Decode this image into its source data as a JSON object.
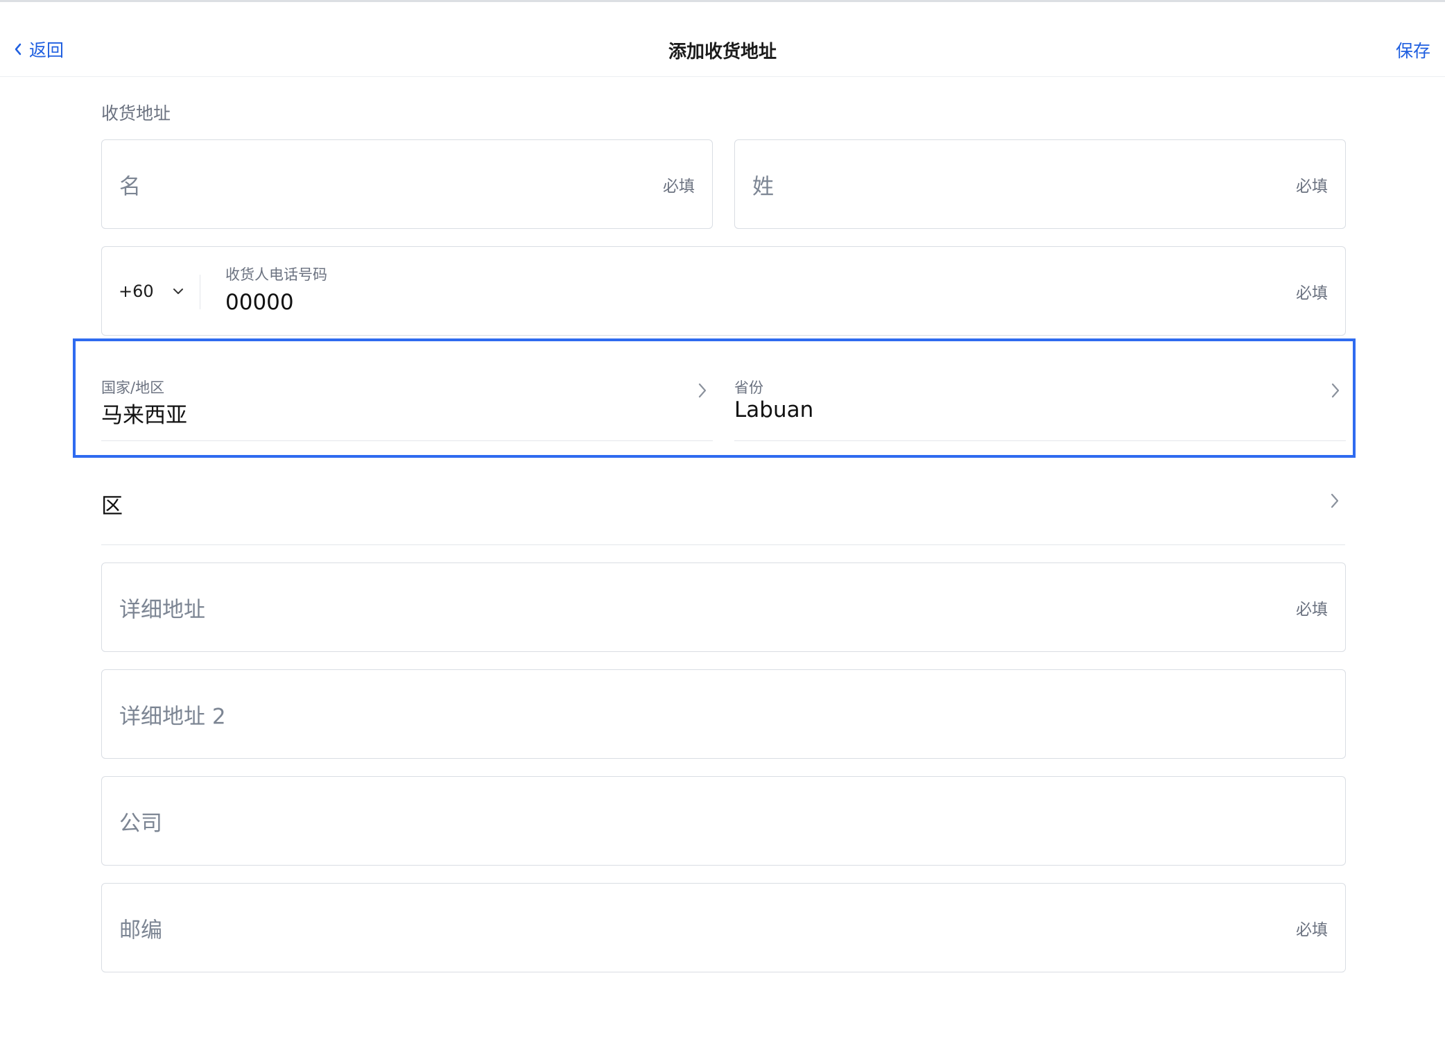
{
  "header": {
    "back_label": "返回",
    "title": "添加收货地址",
    "save_label": "保存"
  },
  "section": {
    "label": "收货地址"
  },
  "fields": {
    "first_name": {
      "placeholder": "名",
      "required": "必填"
    },
    "last_name": {
      "placeholder": "姓",
      "required": "必填"
    },
    "phone": {
      "code": "+60",
      "label": "收货人电话号码",
      "value": "00000",
      "required": "必填"
    },
    "country": {
      "label": "国家/地区",
      "value": "马来西亚"
    },
    "province": {
      "label": "省份",
      "value": "Labuan"
    },
    "district": {
      "label": "区"
    },
    "address1": {
      "placeholder": "详细地址",
      "required": "必填"
    },
    "address2": {
      "placeholder": "详细地址 2"
    },
    "company": {
      "placeholder": "公司"
    },
    "postcode": {
      "placeholder": "邮编",
      "required": "必填"
    }
  },
  "colors": {
    "accent": "#1f5fe0",
    "highlight_border": "#2f6bf0"
  }
}
